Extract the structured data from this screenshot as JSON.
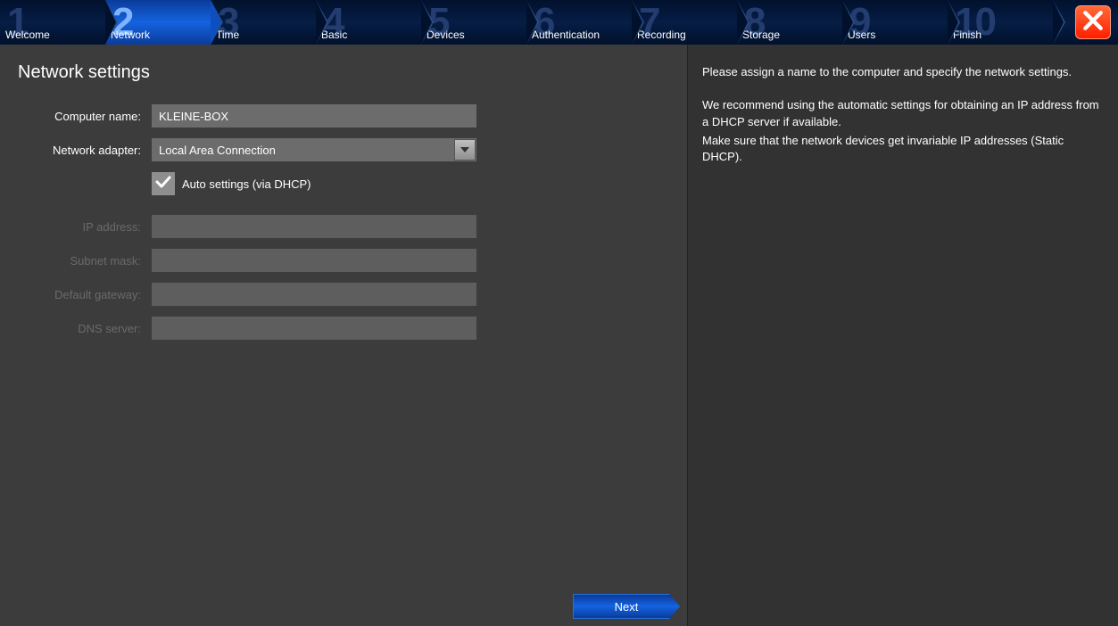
{
  "wizard_steps": [
    {
      "n": "1",
      "label": "Welcome"
    },
    {
      "n": "2",
      "label": "Network"
    },
    {
      "n": "3",
      "label": "Time"
    },
    {
      "n": "4",
      "label": "Basic"
    },
    {
      "n": "5",
      "label": "Devices"
    },
    {
      "n": "6",
      "label": "Authentication"
    },
    {
      "n": "7",
      "label": "Recording"
    },
    {
      "n": "8",
      "label": "Storage"
    },
    {
      "n": "9",
      "label": "Users"
    },
    {
      "n": "10",
      "label": "Finish"
    }
  ],
  "active_step_index": 1,
  "page_title": "Network settings",
  "form": {
    "computer_name_label": "Computer name:",
    "computer_name_value": "KLEINE-BOX",
    "network_adapter_label": "Network adapter:",
    "network_adapter_value": "Local Area Connection",
    "auto_settings_label": "Auto settings (via DHCP)",
    "auto_settings_checked": true,
    "ip_address_label": "IP address:",
    "ip_address_value": "",
    "subnet_mask_label": "Subnet mask:",
    "subnet_mask_value": "",
    "default_gateway_label": "Default gateway:",
    "default_gateway_value": "",
    "dns_server_label": "DNS server:",
    "dns_server_value": ""
  },
  "next_button_label": "Next",
  "help": {
    "p1": "Please assign a name to the computer and specify the network settings.",
    "p2": "We recommend using the automatic settings for obtaining an IP address from a DHCP server if available.",
    "p3": "Make sure that the network devices get invariable IP addresses (Static DHCP)."
  }
}
